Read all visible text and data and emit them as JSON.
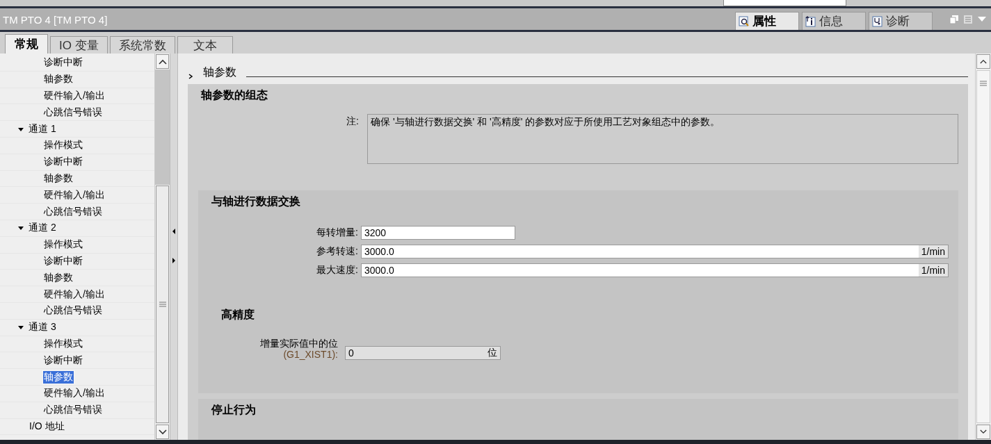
{
  "window": {
    "title": "TM PTO 4 [TM PTO 4]"
  },
  "inspector_tabs": [
    {
      "label": "属性",
      "kind": "properties",
      "selected": true
    },
    {
      "label": "信息",
      "kind": "info",
      "selected": false
    },
    {
      "label": "诊断",
      "kind": "diagnostics",
      "selected": false
    }
  ],
  "tabs": [
    {
      "label": "常规",
      "selected": true
    },
    {
      "label": "IO 变量",
      "selected": false
    },
    {
      "label": "系统常数",
      "selected": false
    },
    {
      "label": "文本",
      "selected": false
    }
  ],
  "tree": {
    "continued_children": [
      {
        "label": "诊断中断",
        "selected": false
      },
      {
        "label": "轴参数",
        "selected": false
      },
      {
        "label": "硬件输入/输出",
        "selected": false
      },
      {
        "label": "心跳信号错误",
        "selected": false
      }
    ],
    "items": [
      {
        "label": "通道 1",
        "expanded": true,
        "children": [
          {
            "label": "操作模式",
            "selected": false
          },
          {
            "label": "诊断中断",
            "selected": false
          },
          {
            "label": "轴参数",
            "selected": false
          },
          {
            "label": "硬件输入/输出",
            "selected": false
          },
          {
            "label": "心跳信号错误",
            "selected": false
          }
        ]
      },
      {
        "label": "通道 2",
        "expanded": true,
        "children": [
          {
            "label": "操作模式",
            "selected": false
          },
          {
            "label": "诊断中断",
            "selected": false
          },
          {
            "label": "轴参数",
            "selected": false
          },
          {
            "label": "硬件输入/输出",
            "selected": false
          },
          {
            "label": "心跳信号错误",
            "selected": false
          }
        ]
      },
      {
        "label": "通道 3",
        "expanded": true,
        "children": [
          {
            "label": "操作模式",
            "selected": false
          },
          {
            "label": "诊断中断",
            "selected": false
          },
          {
            "label": "轴参数",
            "selected": true
          },
          {
            "label": "硬件输入/输出",
            "selected": false
          },
          {
            "label": "心跳信号错误",
            "selected": false
          }
        ]
      },
      {
        "label": "I/O 地址"
      }
    ]
  },
  "breadcrumb": "轴参数",
  "section": {
    "title": "轴参数的组态",
    "note_label": "注:",
    "note": "确保 '与轴进行数据交换' 和 '高精度' 的参数对应于所使用工艺对象组态中的参数。",
    "exchange": {
      "title": "与轴进行数据交换",
      "fields": [
        {
          "label": "每转增量:",
          "value": "3200",
          "disabled": false
        },
        {
          "label": "参考转速:",
          "value": "3000.0",
          "unit": "1/min",
          "disabled": false
        },
        {
          "label": "最大速度:",
          "value": "3000.0",
          "unit": "1/min",
          "disabled": false
        }
      ]
    },
    "precision": {
      "title": "高精度",
      "fields": [
        {
          "label": "增量实际值中的位",
          "sublabel": "(G1_XIST1):",
          "value": "0",
          "unit": "位",
          "disabled": true
        }
      ]
    }
  },
  "next_section": {
    "title": "停止行为"
  }
}
